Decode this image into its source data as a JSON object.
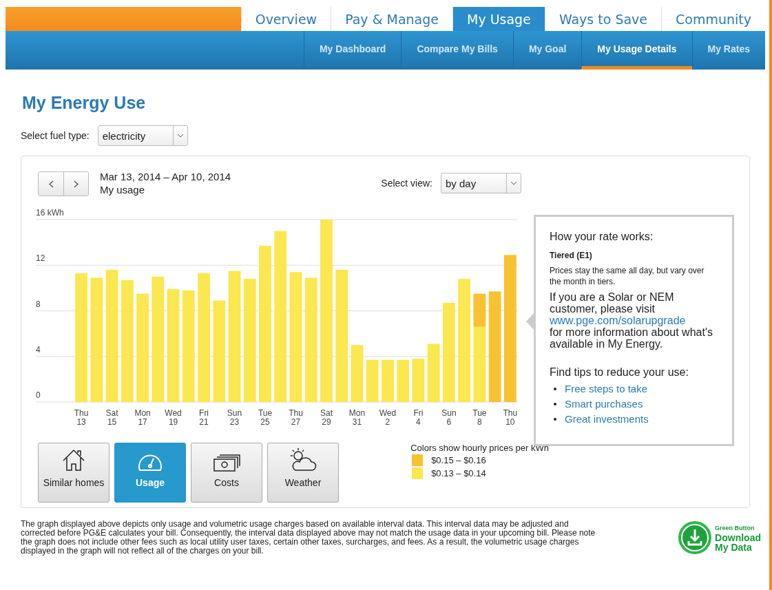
{
  "main_tabs": [
    {
      "label": "Overview",
      "selected": false
    },
    {
      "label": "Pay & Manage",
      "selected": false
    },
    {
      "label": "My Usage",
      "selected": true
    },
    {
      "label": "Ways to Save",
      "selected": false
    },
    {
      "label": "Community",
      "selected": false
    }
  ],
  "sub_tabs": [
    {
      "label": "My Dashboard",
      "selected": false
    },
    {
      "label": "Compare My Bills",
      "selected": false
    },
    {
      "label": "My Goal",
      "selected": false
    },
    {
      "label": "My Usage Details",
      "selected": true
    },
    {
      "label": "My Rates",
      "selected": false
    }
  ],
  "title": "My Energy Use",
  "fuel": {
    "label": "Select fuel type:",
    "value": "electricity"
  },
  "period": {
    "dates": "Mar 13, 2014 – Apr 10, 2014",
    "subtitle": "My usage"
  },
  "view": {
    "label": "Select view:",
    "value": "by day"
  },
  "chart_data": {
    "type": "bar",
    "stacked": true,
    "grid": true,
    "ylim": [
      0,
      16
    ],
    "yticks": [
      0,
      4,
      8,
      12,
      {
        "value": 16,
        "label": "16 kWh"
      }
    ],
    "categories": [
      "Thu 13",
      null,
      "Sat 15",
      null,
      "Mon 17",
      null,
      "Wed 19",
      null,
      "Fri 21",
      null,
      "Sun 23",
      null,
      "Tue 25",
      null,
      "Thu 27",
      null,
      "Sat 29",
      null,
      "Mon 31",
      null,
      "Wed 2",
      null,
      "Fri 4",
      null,
      "Sun 6",
      null,
      "Tue 8",
      null,
      "Thu 10"
    ],
    "series": [
      {
        "name": "$0.13 – $0.14",
        "color": "#fbe74f",
        "values": [
          11.3,
          10.9,
          11.6,
          10.7,
          9.5,
          11.0,
          9.9,
          9.8,
          11.3,
          8.9,
          11.5,
          10.8,
          13.7,
          15.0,
          11.4,
          10.9,
          16.0,
          11.6,
          5.0,
          3.7,
          3.7,
          3.7,
          3.8,
          5.1,
          8.7,
          10.8,
          6.6,
          null,
          null
        ]
      },
      {
        "name": "$0.15 – $0.16",
        "color": "#f7c132",
        "values": [
          null,
          null,
          null,
          null,
          null,
          null,
          null,
          null,
          null,
          null,
          null,
          null,
          null,
          null,
          null,
          null,
          null,
          null,
          null,
          null,
          null,
          null,
          null,
          null,
          null,
          null,
          2.9,
          9.7,
          12.9
        ]
      }
    ]
  },
  "modes": [
    {
      "label": "Similar homes",
      "kind": "house",
      "selected": false
    },
    {
      "label": "Usage",
      "kind": "gauge",
      "selected": true
    },
    {
      "label": "Costs",
      "kind": "money",
      "selected": false
    },
    {
      "label": "Weather",
      "kind": "weather",
      "selected": false
    }
  ],
  "legend": {
    "title": "Colors show hourly prices per kWh"
  },
  "rate_panel": {
    "heading": "How your rate works:",
    "rate_name": "Tiered (E1)",
    "rate_text": "Prices stay the same all day, but vary over the month in tiers.",
    "solar_before": "If you are a Solar or NEM customer, please visit",
    "solar_link": "www.pge.com/solarupgrade",
    "solar_after": "for more information about what's available in My Energy.",
    "tips_heading": "Find tips to reduce your use:",
    "tips": [
      "Free steps to take",
      "Smart purchases",
      "Great investments"
    ]
  },
  "disclaimer": "The graph displayed above depicts only usage and volumetric usage charges based on available interval data. This interval data may be adjusted and corrected before PG&E calculates your bill. Consequently, the interval data displayed above may not match the usage data in your upcoming bill. Please note the graph does not include other fees such as local utility user taxes, certain other taxes, surcharges, and fees. As a result, the volumetric usage charges displayed in the graph will not reflect all of the charges on your bill.",
  "download": {
    "small": "Green Button",
    "line1": "Download",
    "line2": "My Data"
  }
}
